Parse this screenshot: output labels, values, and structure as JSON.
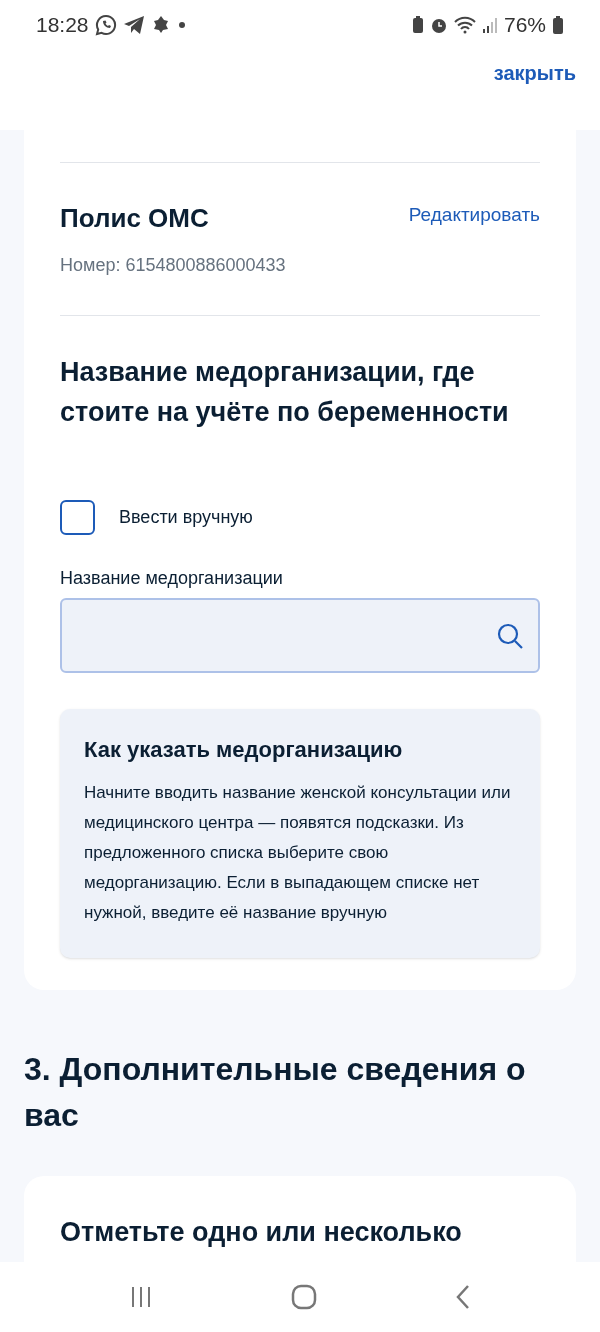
{
  "status_bar": {
    "time": "18:28",
    "battery": "76%"
  },
  "header": {
    "close_link": "закрыть"
  },
  "policy": {
    "title": "Полис ОМС",
    "edit_link": "Редактировать",
    "number": "Номер: 6154800886000433"
  },
  "medorg": {
    "heading": "Название медорганизации, где стоите на учёте по беременности",
    "manual_checkbox": {
      "label": "Ввести вручную",
      "checked": false
    },
    "field_label": "Название медорганизации",
    "hint": {
      "title": "Как указать медорганизацию",
      "text": "Начните вводить название женской консультации или медицинского центра — появятся подсказки. Из предложенного списка выберите свою медорганизацию. Если в выпадающем списке нет нужной, введите её название вручную"
    }
  },
  "section_3": {
    "heading": "3. Дополнительные сведения о вас",
    "card_title": "Отметьте одно или несколько"
  }
}
